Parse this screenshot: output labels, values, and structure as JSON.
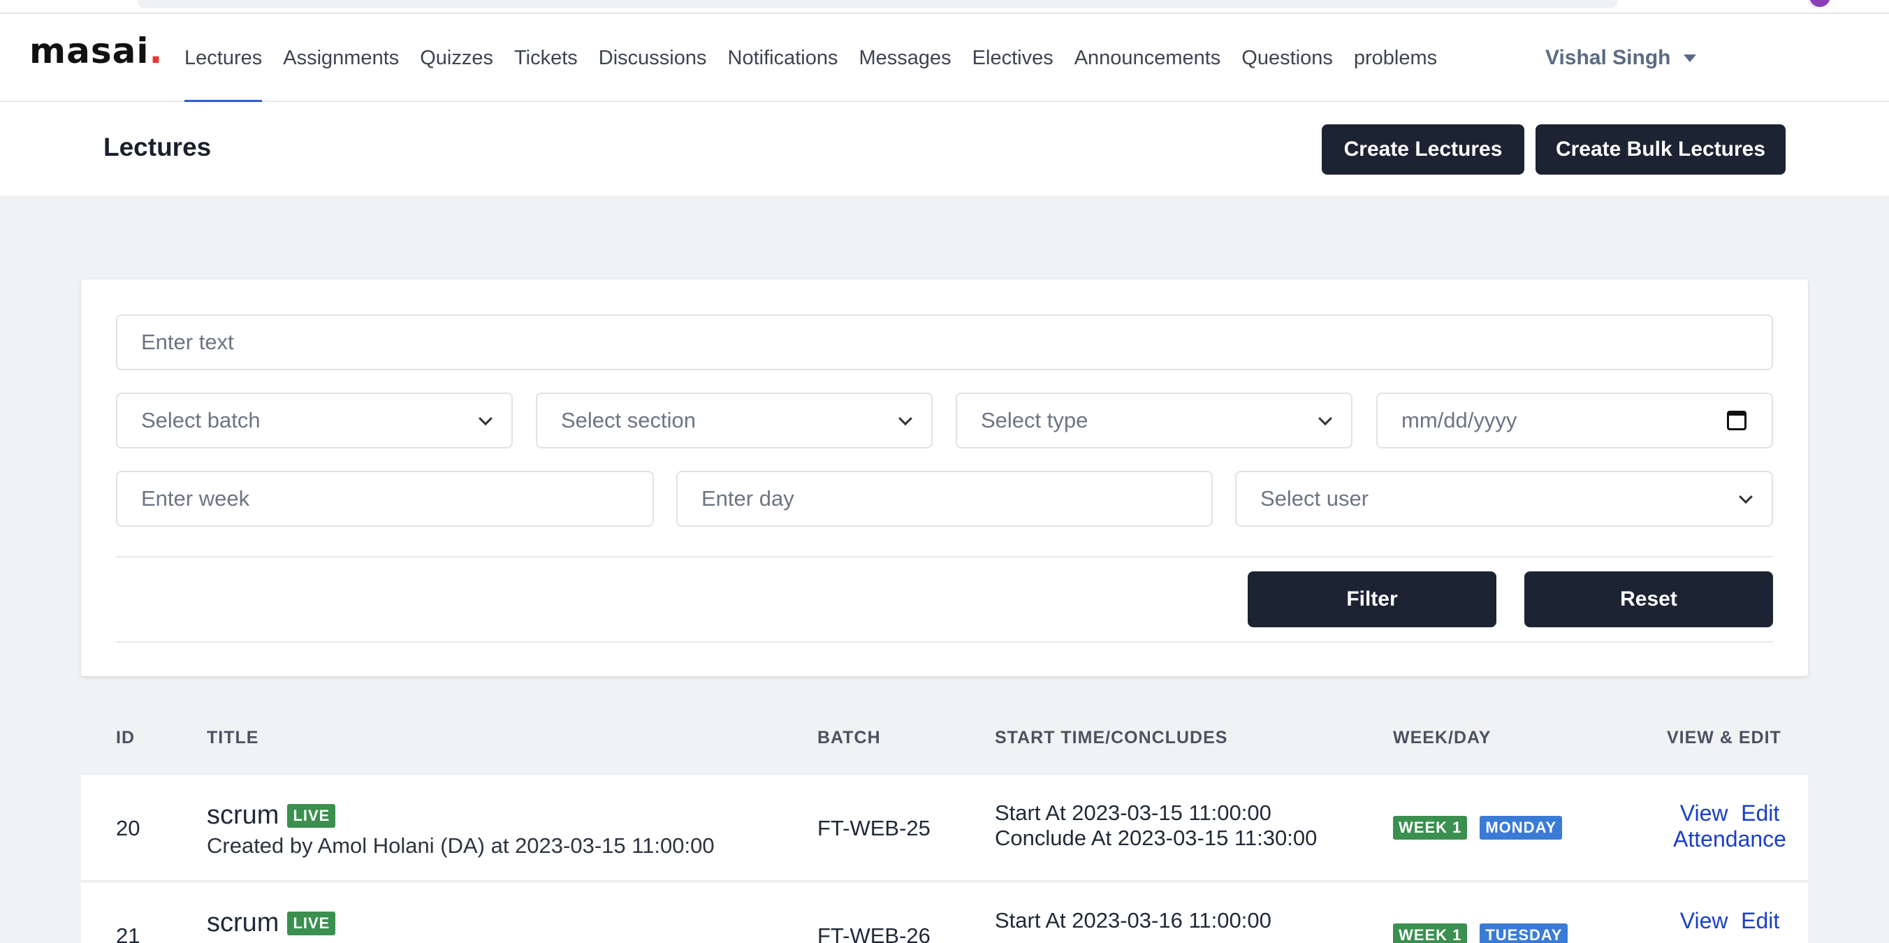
{
  "nav": {
    "logo": "masai",
    "logo_dot": ".",
    "items": [
      "Lectures",
      "Assignments",
      "Quizzes",
      "Tickets",
      "Discussions",
      "Notifications",
      "Messages",
      "Electives",
      "Announcements",
      "Questions",
      "problems"
    ],
    "active": "Lectures",
    "user_name": "Vishal Singh"
  },
  "header": {
    "title": "Lectures",
    "create_label": "Create Lectures",
    "bulk_label": "Create Bulk Lectures"
  },
  "filters": {
    "text_placeholder": "Enter text",
    "batch_placeholder": "Select batch",
    "section_placeholder": "Select section",
    "type_placeholder": "Select type",
    "date_placeholder": "mm/dd/yyyy",
    "week_placeholder": "Enter week",
    "day_placeholder": "Enter day",
    "user_placeholder": "Select user",
    "filter_label": "Filter",
    "reset_label": "Reset"
  },
  "table": {
    "headers": {
      "id": "ID",
      "title": "TITLE",
      "batch": "BATCH",
      "time": "START TIME/CONCLUDES",
      "weekday": "WEEK/DAY",
      "view_edit": "VIEW & EDIT"
    },
    "rows": [
      {
        "id": "20",
        "title": "scrum",
        "badge": "LIVE",
        "created": "Created by Amol Holani (DA) at 2023-03-15 11:00:00",
        "batch": "FT-WEB-25",
        "start": "Start At 2023-03-15 11:00:00",
        "conclude": "Conclude At 2023-03-15 11:30:00",
        "week": "WEEK 1",
        "day": "MONDAY",
        "view": "View",
        "edit": "Edit",
        "attendance": "Attendance"
      },
      {
        "id": "21",
        "title": "scrum",
        "badge": "LIVE",
        "created": "",
        "batch": "FT-WEB-26",
        "start": "Start At 2023-03-16 11:00:00",
        "conclude": "",
        "week": "WEEK 1",
        "day": "TUESDAY",
        "view": "View",
        "edit": "Edit",
        "attendance": ""
      }
    ]
  }
}
